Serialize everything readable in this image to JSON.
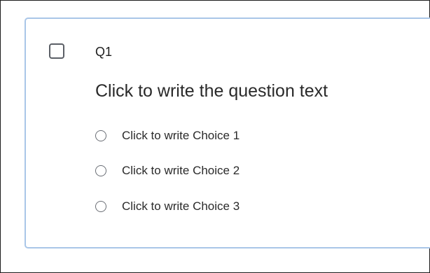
{
  "question": {
    "id_label": "Q1",
    "text": "Click to write the question text",
    "choices": [
      {
        "label": "Click to write Choice 1"
      },
      {
        "label": "Click to write Choice 2"
      },
      {
        "label": "Click to write Choice 3"
      }
    ]
  },
  "colors": {
    "card_border": "#a9c6e8",
    "frame_border": "#1c1c1c",
    "text": "#2a2a2a"
  },
  "icons": {
    "select": "checkbox-icon",
    "choice": "radio-icon"
  }
}
